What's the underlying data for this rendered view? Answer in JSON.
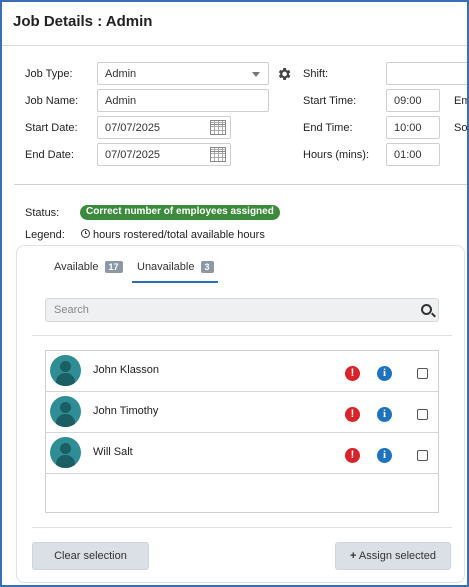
{
  "header": {
    "title": "Job Details : Admin"
  },
  "form": {
    "job_type": {
      "label": "Job Type:",
      "value": "Admin"
    },
    "job_name": {
      "label": "Job Name:",
      "value": "Admin"
    },
    "start_date": {
      "label": "Start Date:",
      "value": "07/07/2025"
    },
    "end_date": {
      "label": "End Date:",
      "value": "07/07/2025"
    },
    "shift": {
      "label": "Shift:",
      "value": ""
    },
    "start_time": {
      "label": "Start Time:",
      "value": "09:00"
    },
    "end_time": {
      "label": "End Time:",
      "value": "10:00"
    },
    "hours": {
      "label": "Hours (mins):",
      "value": "01:00"
    },
    "cut_label_1": "Em",
    "cut_label_2": "So"
  },
  "status": {
    "label": "Status:",
    "badge": "Correct number of employees assigned",
    "badge_color": "#3c8a3c"
  },
  "legend": {
    "label": "Legend:",
    "text": "hours rostered/total available hours"
  },
  "tabs": [
    {
      "label": "Available",
      "count": "17"
    },
    {
      "label": "Unavailable",
      "count": "3"
    }
  ],
  "search": {
    "placeholder": "Search"
  },
  "employees": [
    {
      "name": "John Klasson"
    },
    {
      "name": "John Timothy"
    },
    {
      "name": "Will Salt"
    }
  ],
  "icons": {
    "warn_glyph": "!",
    "info_glyph": "i"
  },
  "buttons": {
    "clear": "Clear selection",
    "assign": "Assign selected",
    "assign_icon": "+"
  },
  "colors": {
    "accent": "#2f6db5",
    "frame": "#3a6fb6",
    "warn": "#d8232a",
    "info": "#1e73be"
  }
}
